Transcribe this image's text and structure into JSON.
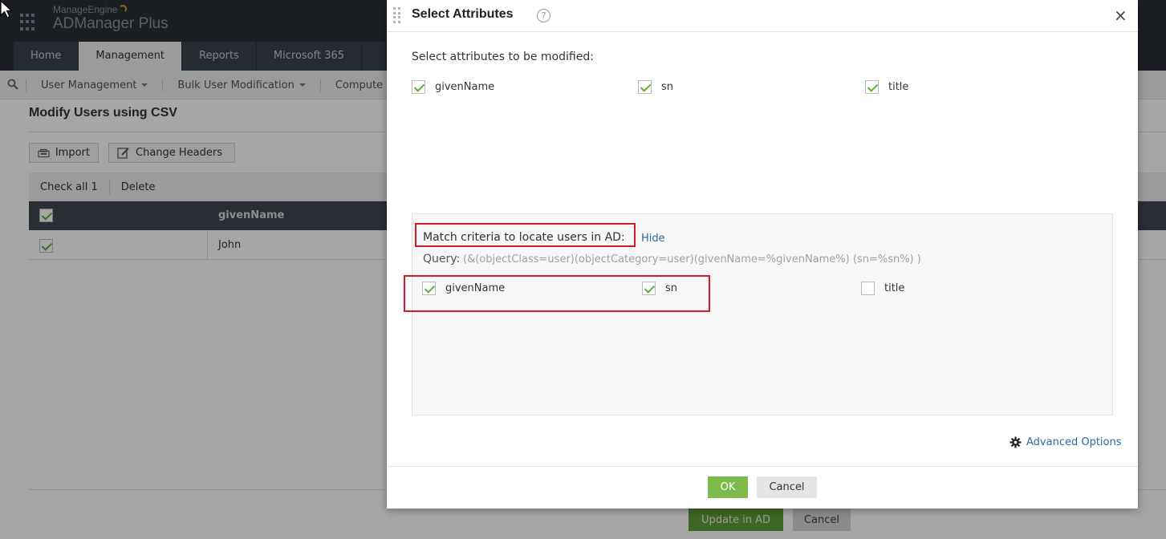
{
  "app": {
    "brand_small": "ManageEngine",
    "brand_name": "ADManager Plus"
  },
  "tabs": [
    {
      "label": "Home",
      "active": false
    },
    {
      "label": "Management",
      "active": true
    },
    {
      "label": "Reports",
      "active": false
    },
    {
      "label": "Microsoft 365",
      "active": false
    },
    {
      "label": "",
      "active": false
    }
  ],
  "subnav": {
    "items": [
      "User Management",
      "Bulk User Modification",
      "Compute"
    ]
  },
  "page": {
    "title": "Modify Users using CSV",
    "import_label": "Import",
    "change_headers_label": "Change Headers",
    "check_all_label": "Check all 1",
    "delete_label": "Delete",
    "column_header": "givenName",
    "row_value": "John",
    "update_label": "Update in AD",
    "cancel_label": "Cancel"
  },
  "modal": {
    "title": "Select Attributes",
    "help_icon": "?",
    "close_icon": "×",
    "select_label": "Select attributes to be modified:",
    "attributes": [
      {
        "name": "givenName",
        "checked": true
      },
      {
        "name": "sn",
        "checked": true
      },
      {
        "name": "title",
        "checked": true
      }
    ],
    "criteria_label": "Match criteria to locate users in AD:",
    "hide_label": "Hide",
    "query_label": "Query:",
    "query_value": "(&(objectClass=user)(objectCategory=user)(givenName=%givenName%) (sn=%sn%) )",
    "match_attributes": [
      {
        "name": "givenName",
        "checked": true
      },
      {
        "name": "sn",
        "checked": true
      },
      {
        "name": "title",
        "checked": false
      }
    ],
    "advanced_options_label": "Advanced Options",
    "ok_label": "OK",
    "cancel_label": "Cancel"
  },
  "colors": {
    "accent_green": "#7cba4c",
    "link_blue": "#2d6a9f",
    "highlight_red": "#d61a22",
    "topbar": "#2a3038"
  }
}
